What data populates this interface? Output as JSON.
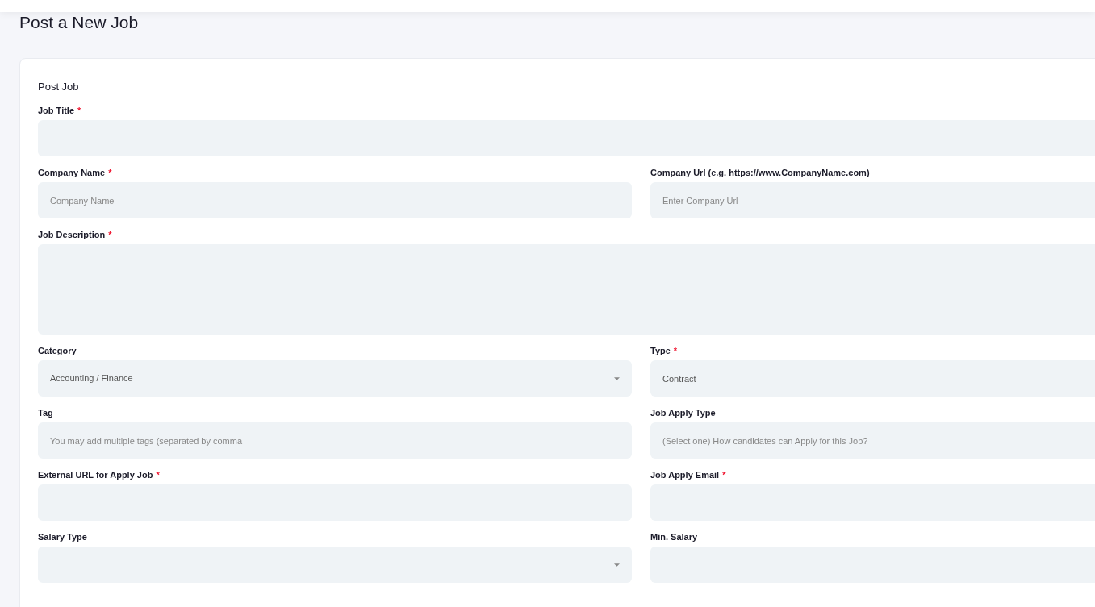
{
  "page_title": "Post a New Job",
  "card_title": "Post Job",
  "required_marker": "*",
  "rows": [
    {
      "fields": [
        {
          "label": "Job Title",
          "required": true,
          "kind": "text"
        }
      ]
    },
    {
      "fields": [
        {
          "label": "Company Name",
          "required": true,
          "kind": "text",
          "placeholder": "Company Name"
        },
        {
          "label": "Company Url (e.g. https://www.CompanyName.com)",
          "required": false,
          "kind": "text",
          "placeholder": "Enter Company Url"
        }
      ]
    },
    {
      "fields": [
        {
          "label": "Job Description",
          "required": true,
          "kind": "textarea"
        }
      ]
    },
    {
      "fields": [
        {
          "label": "Category",
          "required": false,
          "kind": "select",
          "value": "Accounting / Finance"
        },
        {
          "label": "Type",
          "required": true,
          "kind": "text",
          "value": "Contract"
        }
      ]
    },
    {
      "fields": [
        {
          "label": "Tag",
          "required": false,
          "kind": "text",
          "placeholder": "You may add multiple tags (separated by comma"
        },
        {
          "label": "Job Apply Type",
          "required": false,
          "kind": "text",
          "placeholder": "(Select one) How candidates can Apply for this Job?"
        }
      ]
    },
    {
      "fields": [
        {
          "label": "External URL for Apply Job",
          "required": true,
          "kind": "text"
        },
        {
          "label": "Job Apply Email",
          "required": true,
          "kind": "text"
        }
      ]
    },
    {
      "fields": [
        {
          "label": "Salary Type",
          "required": false,
          "kind": "select"
        },
        {
          "label": "Min. Salary",
          "required": false,
          "kind": "text"
        }
      ]
    }
  ]
}
